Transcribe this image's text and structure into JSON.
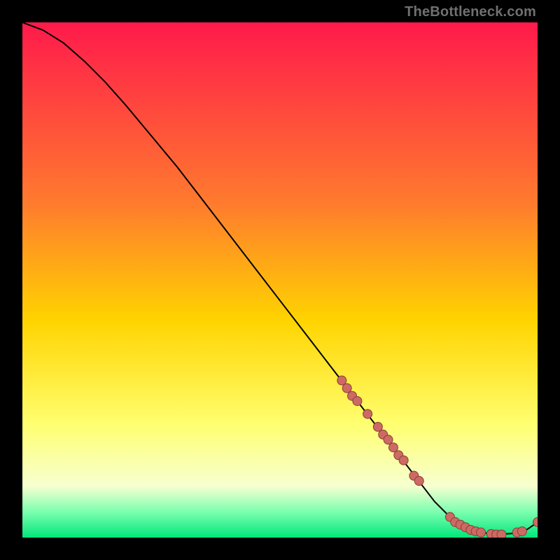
{
  "watermark": "TheBottleneck.com",
  "colors": {
    "gradient_top": "#ff1a4b",
    "gradient_mid1": "#ff7a2e",
    "gradient_mid2": "#ffd400",
    "gradient_mid3": "#ffff70",
    "gradient_bottom1": "#f7ffd0",
    "gradient_bottom2": "#7cffb0",
    "gradient_bottom3": "#00e67a",
    "curve": "#000000",
    "marker_fill": "#cc6a63",
    "marker_stroke": "#8a3e38"
  },
  "chart_data": {
    "type": "line",
    "title": "",
    "xlabel": "",
    "ylabel": "",
    "xlim": [
      0,
      100
    ],
    "ylim": [
      0,
      100
    ],
    "curve": {
      "x": [
        0,
        4,
        8,
        12,
        16,
        20,
        25,
        30,
        35,
        40,
        45,
        50,
        55,
        60,
        65,
        70,
        75,
        80,
        83,
        86,
        89,
        92,
        95,
        98,
        100
      ],
      "y": [
        100,
        98.5,
        96,
        92.5,
        88.5,
        84,
        78,
        72,
        65.5,
        59,
        52.5,
        46,
        39.5,
        33,
        26.5,
        20,
        13.5,
        7,
        4,
        2,
        1,
        0.6,
        0.8,
        1.6,
        3
      ]
    },
    "markers": [
      {
        "x": 62,
        "y": 30.5
      },
      {
        "x": 63,
        "y": 29
      },
      {
        "x": 64,
        "y": 27.5
      },
      {
        "x": 65,
        "y": 26.5
      },
      {
        "x": 67,
        "y": 24
      },
      {
        "x": 69,
        "y": 21.5
      },
      {
        "x": 70,
        "y": 20
      },
      {
        "x": 71,
        "y": 19
      },
      {
        "x": 72,
        "y": 17.5
      },
      {
        "x": 73,
        "y": 16
      },
      {
        "x": 74,
        "y": 15
      },
      {
        "x": 76,
        "y": 12
      },
      {
        "x": 77,
        "y": 11
      },
      {
        "x": 83,
        "y": 4
      },
      {
        "x": 84,
        "y": 3
      },
      {
        "x": 85,
        "y": 2.5
      },
      {
        "x": 86,
        "y": 2
      },
      {
        "x": 87,
        "y": 1.5
      },
      {
        "x": 88,
        "y": 1.2
      },
      {
        "x": 89,
        "y": 1
      },
      {
        "x": 91,
        "y": 0.7
      },
      {
        "x": 92,
        "y": 0.6
      },
      {
        "x": 93,
        "y": 0.6
      },
      {
        "x": 96,
        "y": 1
      },
      {
        "x": 97,
        "y": 1.2
      },
      {
        "x": 100,
        "y": 3
      }
    ]
  }
}
